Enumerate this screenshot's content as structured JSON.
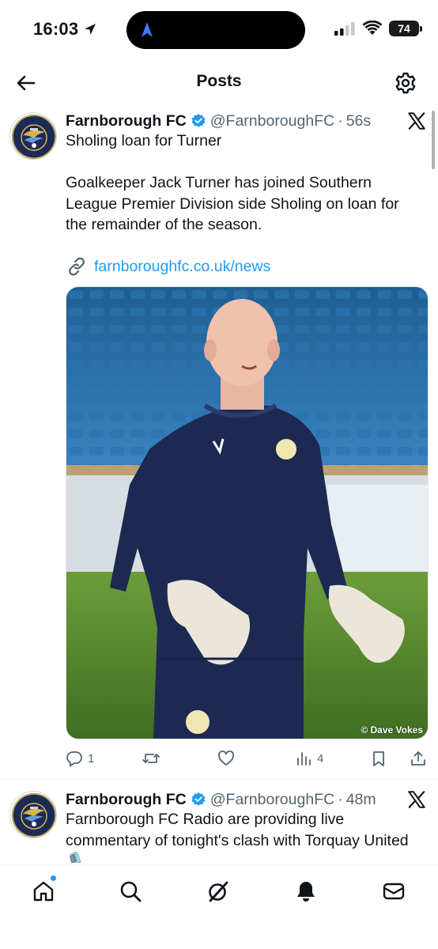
{
  "status_bar": {
    "time": "16:03",
    "battery": "74"
  },
  "header": {
    "title": "Posts"
  },
  "posts": [
    {
      "author": "Farnborough FC",
      "handle": "@FarnboroughFC",
      "separator": "·",
      "time_ago": "56s",
      "text": "Sholing loan for Turner\n\nGoalkeeper Jack Turner has joined Southern League Premier Division side Sholing on loan for the remainder of the season.",
      "link": "farnboroughfc.co.uk/news",
      "photo_credit": "© Dave Vokes",
      "replies": "1",
      "reposts": "",
      "likes": "",
      "views": "4"
    },
    {
      "author": "Farnborough FC",
      "handle": "@FarnboroughFC",
      "separator": "·",
      "time_ago": "48m",
      "text": "Farnborough FC Radio are providing live commentary of tonight's clash with Torquay United 🎙️"
    }
  ],
  "colors": {
    "accent": "#1d9bf0",
    "text": "#0f1419",
    "secondary": "#536471",
    "club_navy": "#1b2a57",
    "club_gold": "#d8b54a"
  },
  "tabbar": {
    "items": [
      "home-icon",
      "search-icon",
      "grok-icon",
      "notifications-icon",
      "messages-icon"
    ]
  }
}
